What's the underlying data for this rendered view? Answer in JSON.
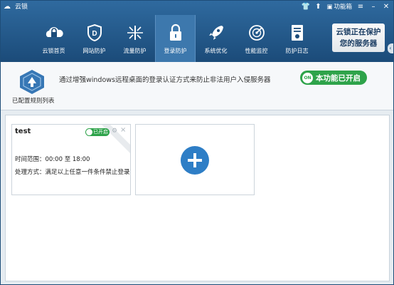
{
  "window": {
    "title": "云锁"
  },
  "titlebar": {
    "function_box_label": "功能箱"
  },
  "nav": {
    "items": [
      {
        "label": "云锁首页",
        "icon": "cloud-lock-icon"
      },
      {
        "label": "网站防护",
        "icon": "shield-d-icon"
      },
      {
        "label": "流量防护",
        "icon": "traffic-icon"
      },
      {
        "label": "登录防护",
        "icon": "padlock-icon",
        "active": true
      },
      {
        "label": "系统优化",
        "icon": "rocket-icon"
      },
      {
        "label": "性能监控",
        "icon": "radar-icon"
      },
      {
        "label": "防护日志",
        "icon": "log-icon"
      }
    ]
  },
  "badge": {
    "line1": "云锁正在保护",
    "line2": "您的服务器"
  },
  "info": {
    "rule_list_label": "已配置规则列表",
    "description": "通过增强windows远程桌面的登录认证方式来防止非法用户入侵服务器",
    "toggle_on": "ON",
    "toggle_label": "本功能已开启"
  },
  "rules": [
    {
      "name": "test",
      "status": "已开启",
      "time_range": "时间范围：00:00 至 18:00",
      "action": "处理方式：满足以上任意一件条件禁止登录"
    }
  ],
  "colors": {
    "header": "#1b4b79",
    "accent_green": "#2ea34a",
    "add_blue": "#2e7ec6"
  }
}
